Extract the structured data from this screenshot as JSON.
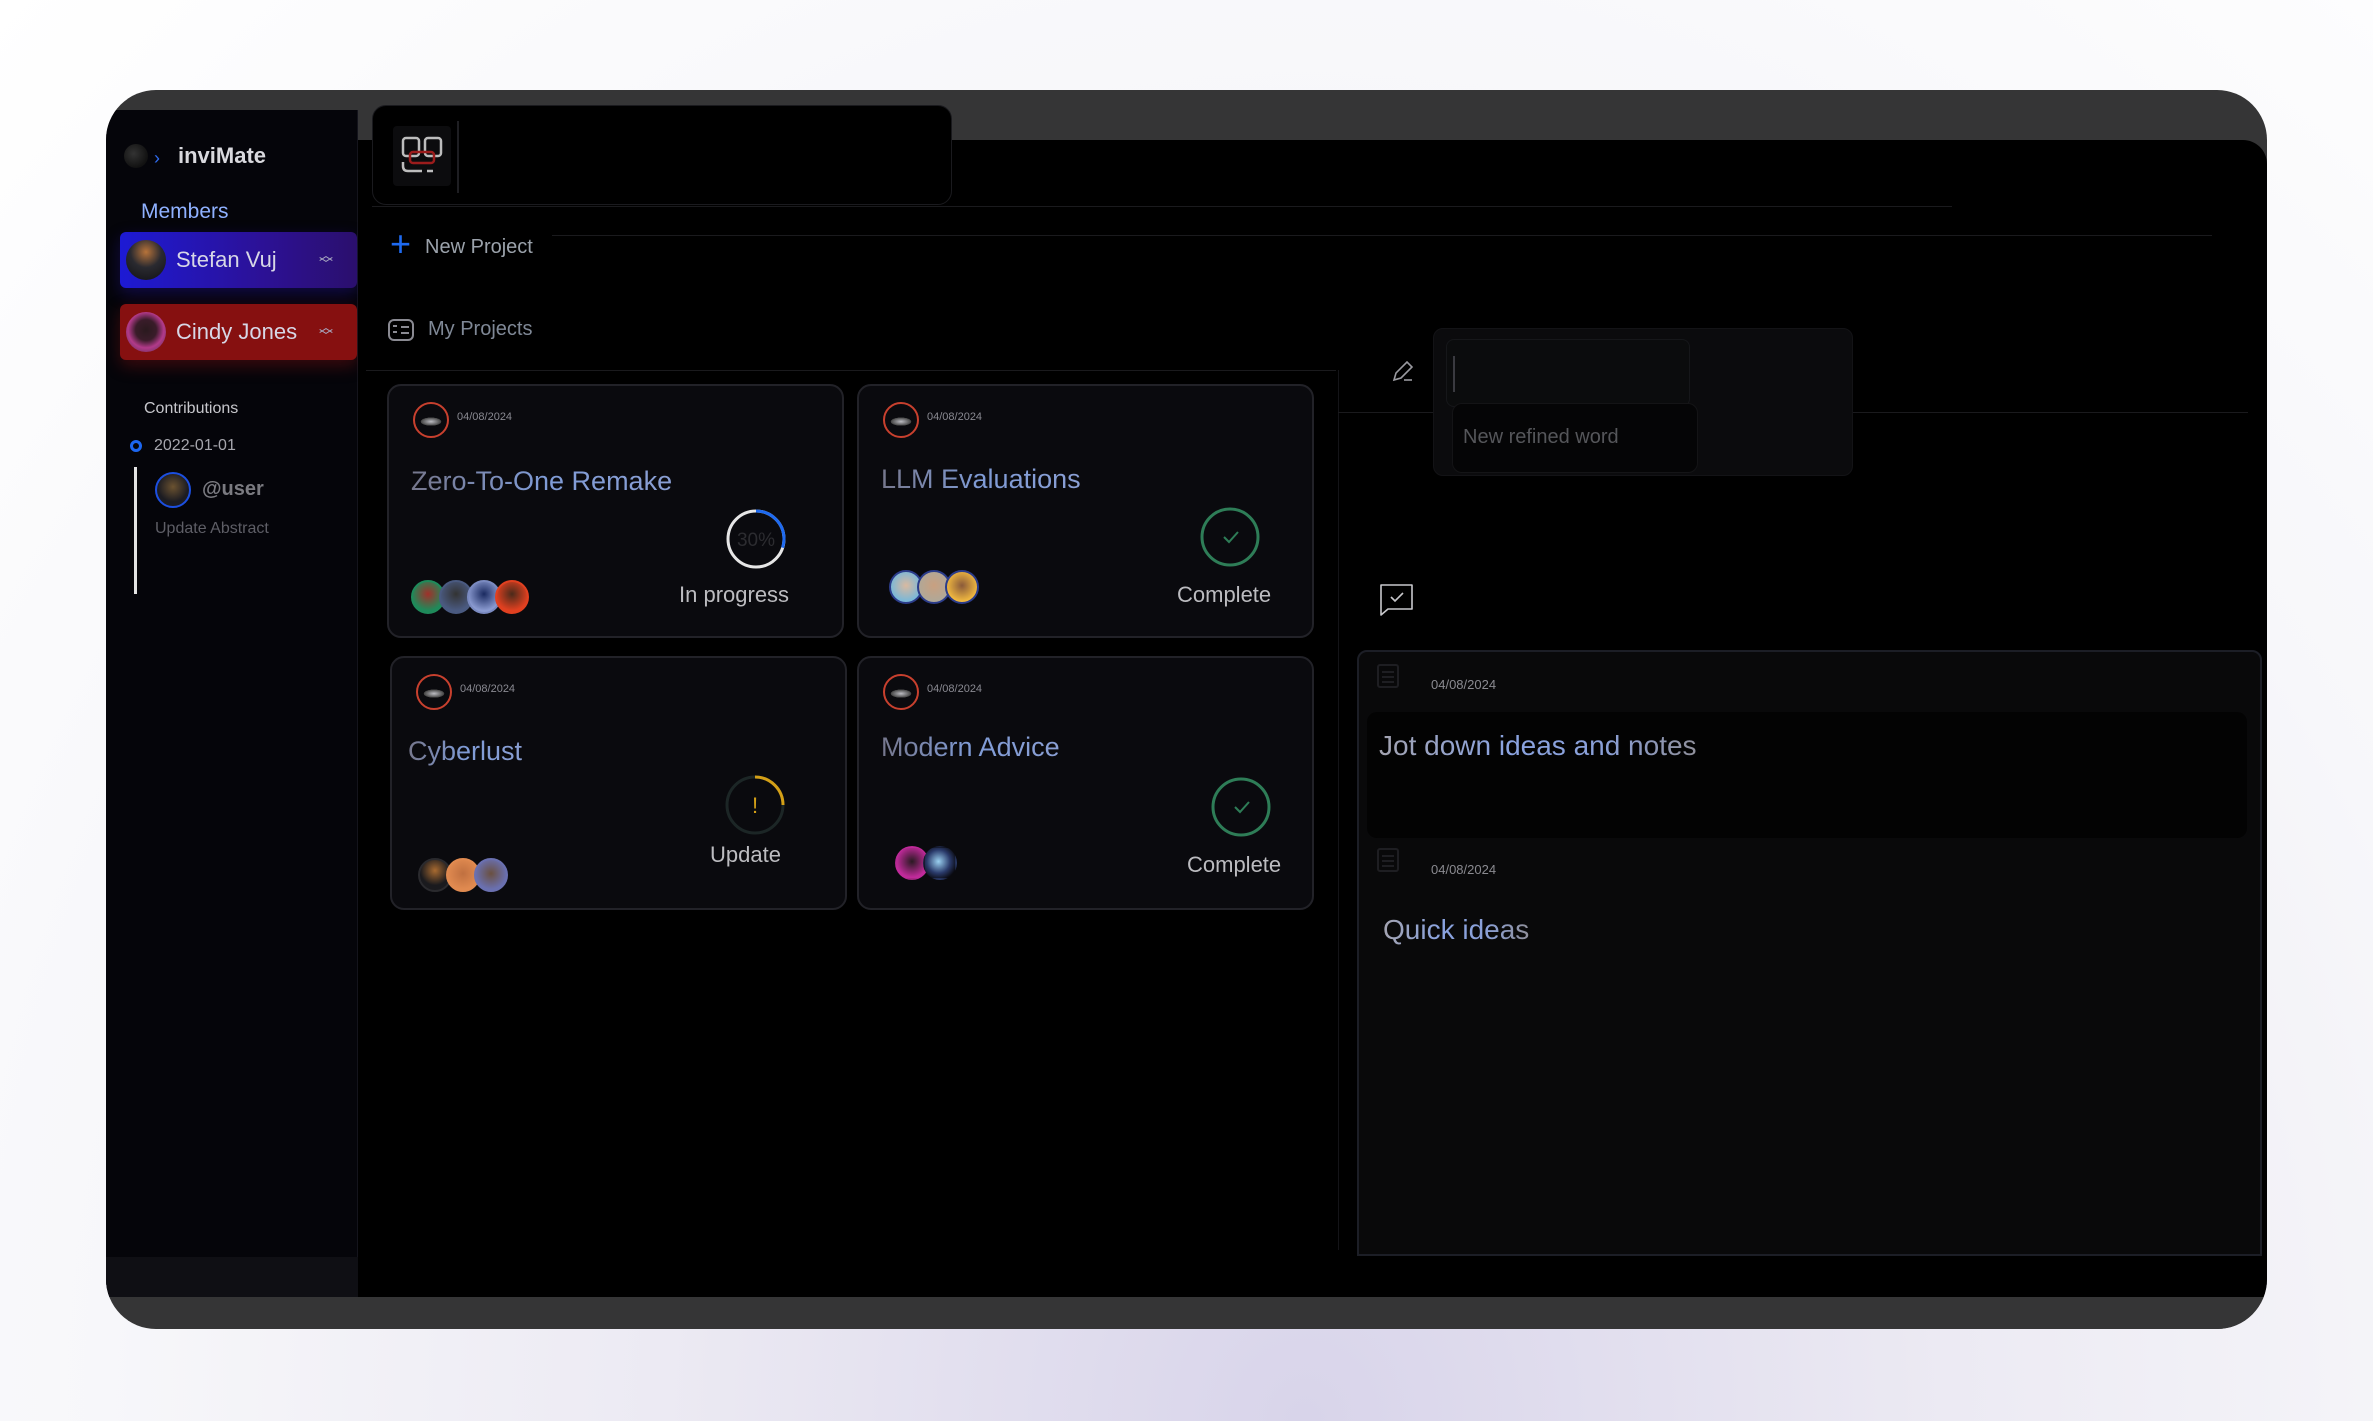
{
  "app": {
    "name": "inviMate"
  },
  "sidebar": {
    "members_label": "Members",
    "members": [
      {
        "name": "Stefan Vuj",
        "color": "#1d1ad4"
      },
      {
        "name": "Cindy Jones",
        "color": "#861010"
      }
    ],
    "contributions_label": "Contributions",
    "contributions": [
      {
        "date": "2022-01-01",
        "user": "@user",
        "action": "Update Abstract"
      }
    ]
  },
  "toolbar": {
    "new_project_label": "New Project"
  },
  "projects": {
    "section_label": "My Projects",
    "items": [
      {
        "title": "Zero-To-One Remake",
        "date": "04/08/2024",
        "status": "In progress",
        "progress_percent": 30,
        "progress_label": "30%",
        "status_kind": "progress",
        "avatar_count": 4
      },
      {
        "title": "LLM Evaluations",
        "date": "04/08/2024",
        "status": "Complete",
        "status_kind": "complete",
        "avatar_count": 3
      },
      {
        "title": "Cyberlust",
        "date": "04/08/2024",
        "status": "Update",
        "status_kind": "update",
        "status_symbol": "!",
        "avatar_count": 3
      },
      {
        "title": "Modern Advice",
        "date": "04/08/2024",
        "status": "Complete",
        "status_kind": "complete",
        "avatar_count": 2
      }
    ]
  },
  "refine": {
    "input_value": "",
    "suggestion_placeholder": "New refined word"
  },
  "notes": [
    {
      "date": "04/08/2024",
      "title": "Jot down ideas and notes"
    },
    {
      "date": "04/08/2024",
      "title": "Quick ideas"
    }
  ],
  "colors": {
    "accent_blue": "#1e6af0",
    "complete_green": "#2e7d57",
    "update_amber": "#d4a017",
    "logo_ring_red": "#c8402e"
  }
}
